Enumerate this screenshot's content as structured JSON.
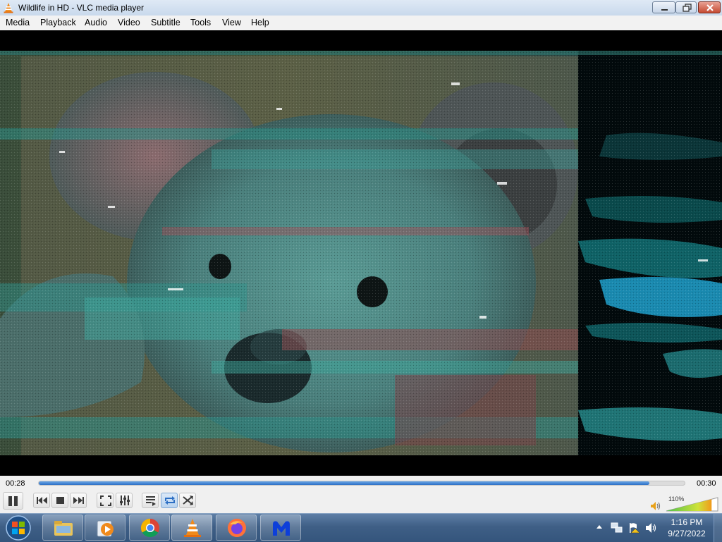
{
  "window": {
    "title": "Wildlife in HD - VLC media player",
    "icon": "vlc-cone-icon"
  },
  "menu": [
    "Media",
    "Playback",
    "Audio",
    "Video",
    "Subtitle",
    "Tools",
    "View",
    "Help"
  ],
  "video": {
    "content": "koala-frame-glitched"
  },
  "playback": {
    "elapsed": "00:28",
    "total": "00:30",
    "progress": 0.945,
    "volume_label": "110%",
    "volume_level": 1.1,
    "repeat_active": true
  },
  "controls": [
    "pause-icon",
    "previous-icon",
    "stop-icon",
    "next-icon",
    "fullscreen-icon",
    "extended-settings-icon",
    "playlist-icon",
    "loop-icon",
    "shuffle-icon"
  ],
  "taskbar": {
    "pinned": [
      "file-explorer-icon",
      "media-player-icon",
      "chrome-icon",
      "vlc-icon",
      "firefox-icon",
      "malwarebytes-icon"
    ],
    "active": "vlc-icon",
    "time": "1:16 PM",
    "date": "9/27/2022",
    "tray": [
      "show-hidden-icons",
      "network-icon",
      "action-center-flag-icon",
      "speaker-icon"
    ]
  },
  "colors": {
    "accent": "#2d6fc4",
    "title_bar": "#c9d9ec",
    "taskbar": "#3f5f86",
    "close_button": "#c54b33"
  }
}
